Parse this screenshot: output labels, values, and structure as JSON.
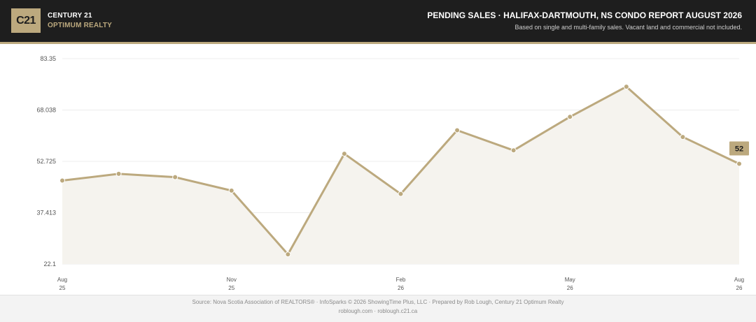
{
  "brand": {
    "logo_text": "C21",
    "name": "CENTURY 21",
    "office": "OPTIMUM REALTY"
  },
  "header": {
    "title": "PENDING SALES  ·  HALIFAX-DARTMOUTH, NS CONDO REPORT AUGUST 2026",
    "subtitle": "Based on single and multi-family sales. Vacant land and commercial not included."
  },
  "colors": {
    "accent": "#bca97e",
    "header_bg": "#1e1e1e",
    "area_fill": "#f5f3ee",
    "grid": "#ececec"
  },
  "chart_data": {
    "type": "area",
    "x": [
      "2025-08",
      "2025-09",
      "2025-10",
      "2025-11",
      "2025-12",
      "2026-01",
      "2026-02",
      "2026-03",
      "2026-04",
      "2026-05",
      "2026-06",
      "2026-07",
      "2026-08"
    ],
    "series": [
      {
        "values": [
          47,
          49,
          48,
          44,
          25,
          55,
          43,
          62,
          56,
          66,
          75,
          60,
          52
        ]
      }
    ],
    "ylim": [
      22.1,
      83.35
    ],
    "yticks": [
      "83.35",
      "68.038",
      "52.725",
      "37.413",
      "22.1"
    ],
    "xticks": [
      {
        "index": 0,
        "month": "Aug",
        "year": "25"
      },
      {
        "index": 3,
        "month": "Nov",
        "year": "25"
      },
      {
        "index": 6,
        "month": "Feb",
        "year": "26"
      },
      {
        "index": 9,
        "month": "May",
        "year": "26"
      },
      {
        "index": 12,
        "month": "Aug",
        "year": "26"
      }
    ],
    "last_value_label": "52",
    "grid": true
  },
  "footer": {
    "source": "Source: Nova Scotia Association of REALTORS® · InfoSparks © 2026 ShowingTime Plus, LLC · Prepared by Rob Lough, Century 21 Optimum Realty",
    "links": "roblough.com · roblough.c21.ca"
  }
}
